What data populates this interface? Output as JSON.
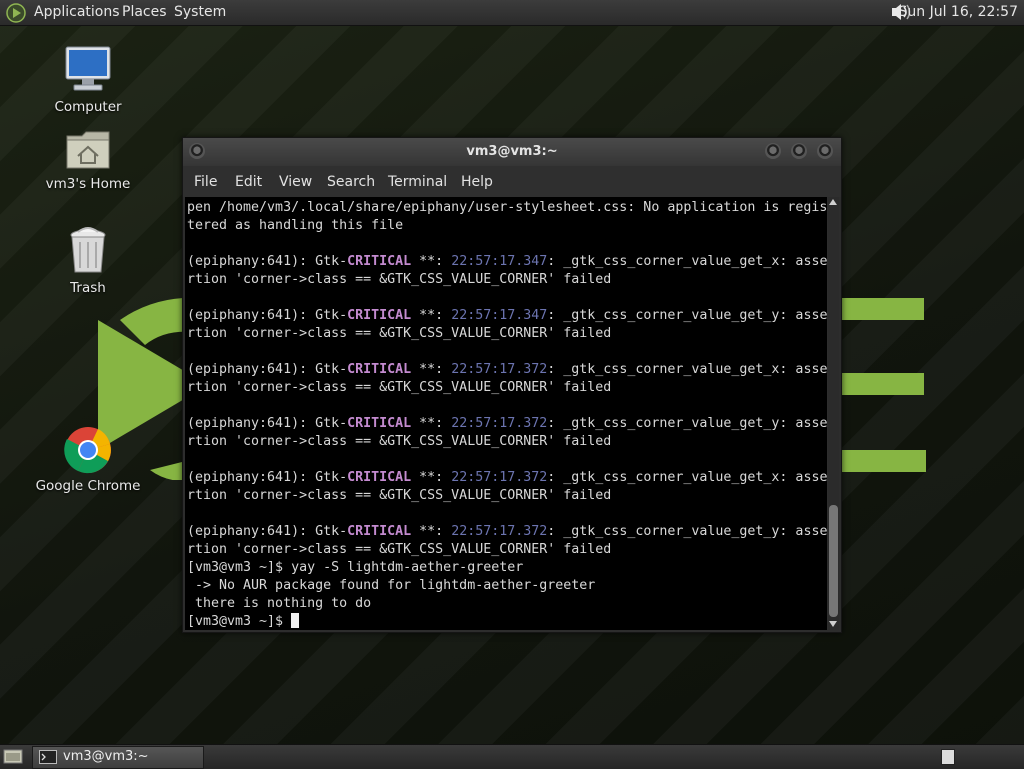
{
  "top_panel": {
    "menus": [
      "Applications",
      "Places",
      "System"
    ],
    "clock": "Sun Jul 16, 22:57",
    "icons": [
      "mate-logo-icon",
      "volume-icon"
    ]
  },
  "desktop": {
    "icons": [
      {
        "label": "Computer",
        "icon": "computer-icon"
      },
      {
        "label": "vm3's Home",
        "icon": "home-folder-icon"
      },
      {
        "label": "Trash",
        "icon": "trash-icon"
      },
      {
        "label": "Google Chrome",
        "icon": "chrome-icon"
      }
    ],
    "accent_color": "#87b543"
  },
  "terminal": {
    "title": "vm3@vm3:~",
    "menu": [
      "File",
      "Edit",
      "View",
      "Search",
      "Terminal",
      "Help"
    ],
    "lines": [
      "pen /home/vm3/.local/share/epiphany/user-stylesheet.css: No application is regis",
      "tered as handling this file",
      "",
      "(epiphany:641): Gtk-CRITICAL **: 22:57:17.347: _gtk_css_corner_value_get_x: asse",
      "rtion 'corner->class == &GTK_CSS_VALUE_CORNER' failed",
      "",
      "(epiphany:641): Gtk-CRITICAL **: 22:57:17.347: _gtk_css_corner_value_get_y: asse",
      "rtion 'corner->class == &GTK_CSS_VALUE_CORNER' failed",
      "",
      "(epiphany:641): Gtk-CRITICAL **: 22:57:17.372: _gtk_css_corner_value_get_x: asse",
      "rtion 'corner->class == &GTK_CSS_VALUE_CORNER' failed",
      "",
      "(epiphany:641): Gtk-CRITICAL **: 22:57:17.372: _gtk_css_corner_value_get_y: asse",
      "rtion 'corner->class == &GTK_CSS_VALUE_CORNER' failed",
      "",
      "(epiphany:641): Gtk-CRITICAL **: 22:57:17.372: _gtk_css_corner_value_get_x: asse",
      "rtion 'corner->class == &GTK_CSS_VALUE_CORNER' failed",
      "",
      "(epiphany:641): Gtk-CRITICAL **: 22:57:17.372: _gtk_css_corner_value_get_y: asse",
      "rtion 'corner->class == &GTK_CSS_VALUE_CORNER' failed",
      "[vm3@vm3 ~]$ yay -S lightdm-aether-greeter",
      " -> No AUR package found for lightdm-aether-greeter",
      " there is nothing to do",
      "[vm3@vm3 ~]$ "
    ],
    "colors": {
      "critical": "#c48bd0",
      "timestamp": "#6c74b0",
      "text": "#d8d8d8"
    }
  },
  "bottom_panel": {
    "task_label": "vm3@vm3:~",
    "icons": [
      "show-desktop-icon",
      "terminal-icon",
      "workspace-switcher-icon"
    ]
  }
}
